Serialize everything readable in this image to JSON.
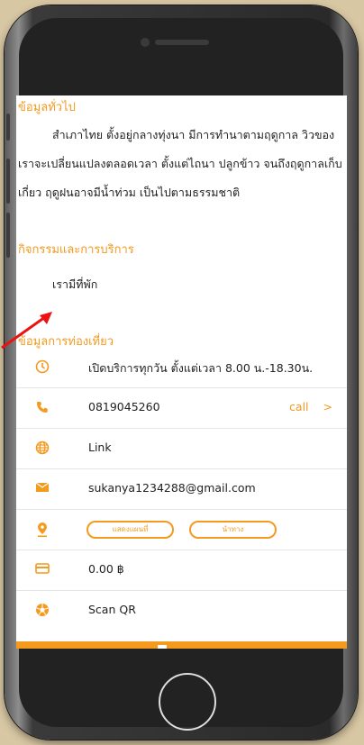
{
  "colors": {
    "accent": "#f39a1f",
    "background": "#d8c7a3"
  },
  "general": {
    "title": "ข้อมูลทั่วไป",
    "paragraph": "สำเภาไทย ตั้งอยู่กลางทุ่งนา มีการทำนาตามฤดูกาล วิวของเราจะเปลี่ยนแปลงตลอดเวลา ตั้งแต่ไถนา ปลูกข้าว จนถึงฤดูกาลเก็บเกี่ยว ฤดูฝนอาจมีน้ำท่วม เป็นไปตามธรรมชาติ"
  },
  "activities": {
    "title": "กิจกรรมและการบริการ",
    "item": "เรามีที่พัก"
  },
  "travel": {
    "title": "ข้อมูลการท่องเที่ยว",
    "hours": "เปิดบริการทุกวัน ตั้งแต่เวลา 8.00 น.-18.30น.",
    "phone": "0819045260",
    "call_label": "call",
    "call_chevron": ">",
    "link": "Link",
    "email": "sukanya1234288@gmail.com",
    "map_button": "แสดงแผนที่",
    "nav_button": "นำทาง",
    "price": "0.00 ฿",
    "scan": "Scan QR"
  },
  "icons": {
    "clock": "clock-icon",
    "phone": "phone-icon",
    "globe": "globe-icon",
    "mail": "mail-icon",
    "pin": "map-pin-icon",
    "card": "credit-card-icon",
    "qr": "camera-icon"
  }
}
